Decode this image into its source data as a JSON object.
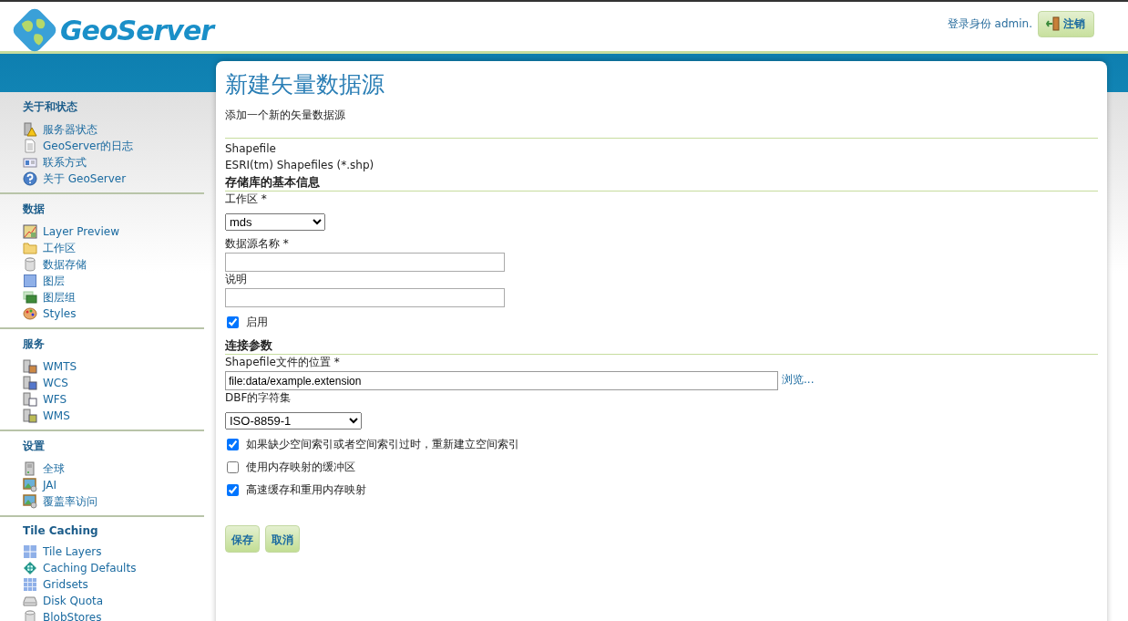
{
  "header": {
    "logo": "GeoServer",
    "login_text": "登录身份 admin.",
    "logout_button": "注销"
  },
  "sidebar": [
    {
      "title": "关于和状态",
      "items": [
        {
          "label": "服务器状态",
          "kind": "server-warning"
        },
        {
          "label": "GeoServer的日志",
          "kind": "document"
        },
        {
          "label": "联系方式",
          "kind": "contact-card"
        },
        {
          "label": "关于 GeoServer",
          "kind": "help"
        }
      ]
    },
    {
      "title": "数据",
      "items": [
        {
          "label": "Layer Preview",
          "kind": "map"
        },
        {
          "label": "工作区",
          "kind": "folder"
        },
        {
          "label": "数据存储",
          "kind": "database"
        },
        {
          "label": "图层",
          "kind": "layer"
        },
        {
          "label": "图层组",
          "kind": "layer-group"
        },
        {
          "label": "Styles",
          "kind": "palette"
        }
      ]
    },
    {
      "title": "服务",
      "items": [
        {
          "label": "WMTS",
          "kind": "server-tiles"
        },
        {
          "label": "WCS",
          "kind": "server-grid"
        },
        {
          "label": "WFS",
          "kind": "server-doc"
        },
        {
          "label": "WMS",
          "kind": "server-map"
        }
      ]
    },
    {
      "title": "设置",
      "items": [
        {
          "label": "全球",
          "kind": "server"
        },
        {
          "label": "JAI",
          "kind": "image-gear"
        },
        {
          "label": "覆盖率访问",
          "kind": "image-gear"
        }
      ]
    },
    {
      "title": "Tile Caching",
      "items": [
        {
          "label": "Tile Layers",
          "kind": "tiles"
        },
        {
          "label": "Caching Defaults",
          "kind": "globe"
        },
        {
          "label": "Gridsets",
          "kind": "grid"
        },
        {
          "label": "Disk Quota",
          "kind": "disk"
        },
        {
          "label": "BlobStores",
          "kind": "database"
        }
      ]
    }
  ],
  "page": {
    "title": "新建矢量数据源",
    "subtitle": "添加一个新的矢量数据源",
    "store_type": "Shapefile",
    "store_description": "ESRI(tm) Shapefiles (*.shp)",
    "sections": [
      {
        "heading": "存储库的基本信息",
        "fields": [
          {
            "kind": "select",
            "label": "工作区 *",
            "value": "mds"
          },
          {
            "kind": "text",
            "label": "数据源名称 *"
          },
          {
            "kind": "text",
            "label": "说明"
          },
          {
            "kind": "checkbox",
            "label": "启用",
            "checked": true
          }
        ]
      },
      {
        "heading": "连接参数",
        "fields": [
          {
            "kind": "file",
            "label": "Shapefile文件的位置 *",
            "value": "file:data/example.extension",
            "link": "浏览..."
          },
          {
            "kind": "select",
            "label": "DBF的字符集",
            "value": "ISO-8859-1"
          },
          {
            "kind": "checkbox",
            "label": "如果缺少空间索引或者空间索引过时，重新建立空间索引",
            "checked": true
          },
          {
            "kind": "checkbox",
            "label": "使用内存映射的缓冲区",
            "checked": false
          },
          {
            "kind": "checkbox",
            "label": "高速缓存和重用内存映射",
            "checked": true
          }
        ]
      }
    ],
    "buttons": [
      "保存",
      "取消"
    ]
  }
}
